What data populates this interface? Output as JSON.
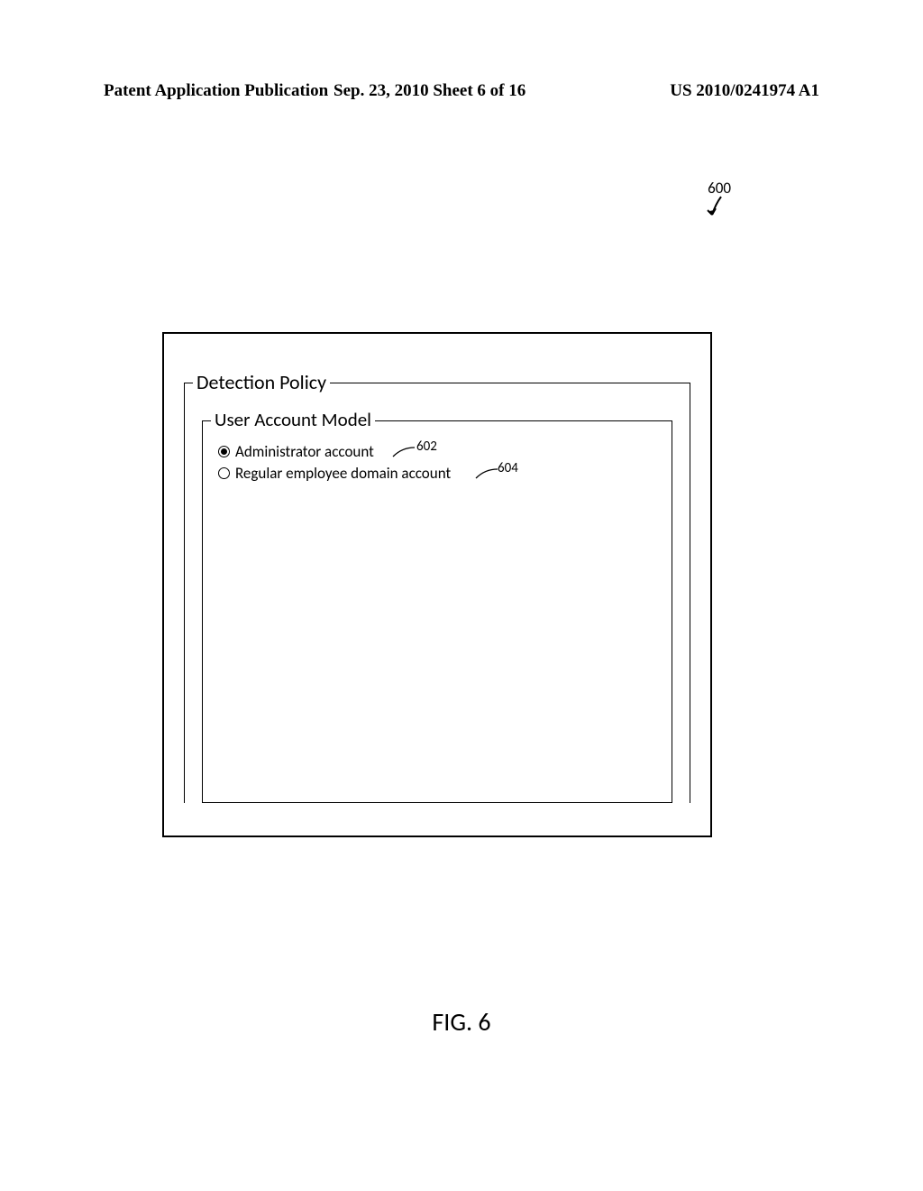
{
  "header": {
    "left": "Patent Application Publication",
    "center": "Sep. 23, 2010  Sheet 6 of 16",
    "right": "US 2010/0241974 A1"
  },
  "figure": {
    "ref_number": "600",
    "label": "FIG. 6"
  },
  "ui": {
    "outer_legend": "Detection Policy",
    "inner_legend": "User Account Model",
    "options": [
      {
        "label": "Administrator account",
        "selected": true,
        "callout": "602"
      },
      {
        "label": "Regular employee domain account",
        "selected": false,
        "callout": "604"
      }
    ]
  }
}
